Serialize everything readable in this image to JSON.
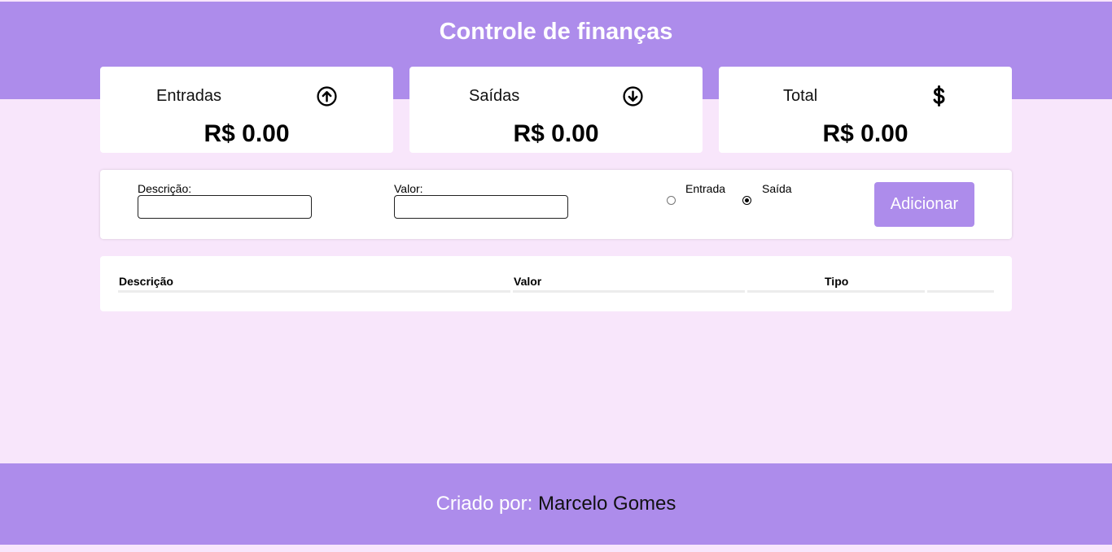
{
  "header": {
    "title": "Controle de finanças"
  },
  "cards": {
    "income": {
      "label": "Entradas",
      "amount": "R$ 0.00",
      "icon": "arrow-up-circle-icon"
    },
    "expense": {
      "label": "Saídas",
      "amount": "R$ 0.00",
      "icon": "arrow-down-circle-icon"
    },
    "total": {
      "label": "Total",
      "amount": "R$ 0.00",
      "icon": "dollar-sign-icon"
    }
  },
  "form": {
    "description_label": "Descrição:",
    "description_value": "",
    "value_label": "Valor:",
    "value_value": "",
    "type_options": [
      "Entrada",
      "Saída"
    ],
    "type_selected": "Saída",
    "add_label": "Adicionar"
  },
  "table": {
    "headers": [
      "Descrição",
      "Valor",
      "Tipo",
      ""
    ],
    "rows": []
  },
  "footer": {
    "prefix": "Criado por:",
    "author": "Marcelo Gomes"
  },
  "colors": {
    "accent": "#ad8ceb",
    "background": "#f8e6fb",
    "card": "#ffffff"
  }
}
